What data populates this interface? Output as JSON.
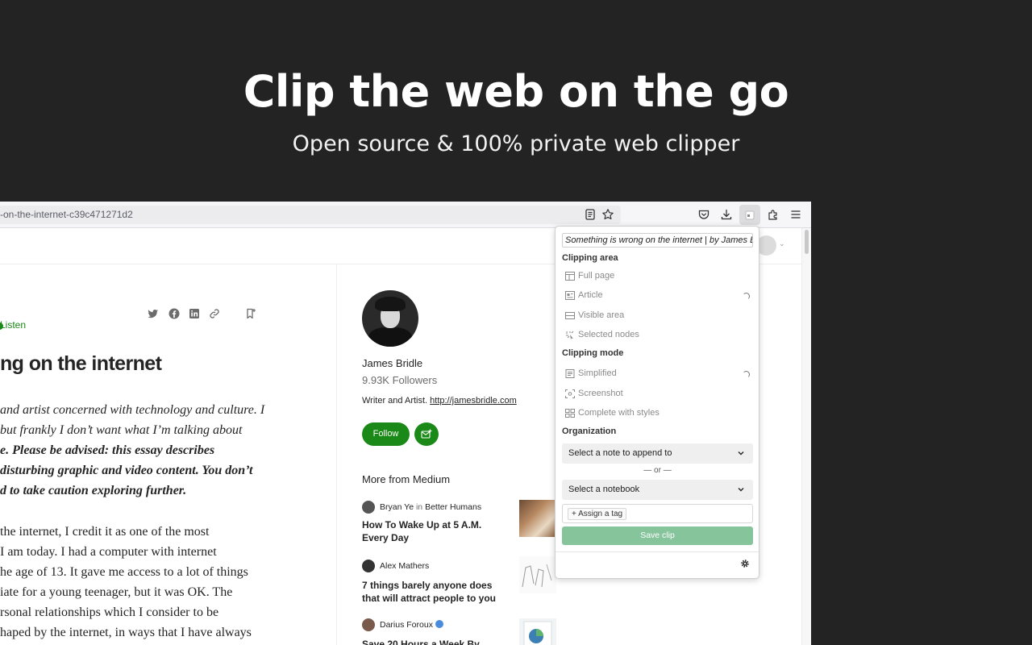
{
  "hero": {
    "title": "Clip the web on the go",
    "subtitle": "Open source & 100% private web clipper"
  },
  "browser": {
    "url": "-on-the-internet-c39c471271d2",
    "toolbar_icons": [
      "reader-view-icon",
      "bookmark-star-icon",
      "pocket-icon",
      "download-icon",
      "clipper-extension-icon",
      "extensions-icon",
      "menu-icon"
    ]
  },
  "article": {
    "listen_label": "Listen",
    "title": "ng on the internet",
    "intro_lines": [
      "and artist concerned with technology and culture. I",
      "but frankly I don’t want what I’m talking about",
      "e. Please be advised: this essay describes",
      "disturbing graphic and video content. You don’t",
      "d to take caution exploring further."
    ],
    "body_lines": [
      "the internet, I credit it as one of the most",
      " I am today. I had a computer with internet",
      "he age of 13. It gave me access to a lot of things",
      "iate for a young teenager, but it was OK. The",
      "rsonal relationships which I consider to be",
      "haped by the internet, in ways that I have always"
    ]
  },
  "sidebar": {
    "author_name": "James Bridle",
    "followers": "9.93K Followers",
    "bio_prefix": "Writer and Artist. ",
    "bio_link": "http://jamesbridle.com",
    "follow_label": "Follow",
    "more_from": "More from Medium",
    "recommendations": [
      {
        "author": "Bryan Ye",
        "in_label": "in",
        "publication": "Better Humans",
        "title": "How To Wake Up at 5 A.M. Every Day"
      },
      {
        "author": "Alex Mathers",
        "in_label": "",
        "publication": "",
        "title": "7 things barely anyone does that will attract people to you"
      },
      {
        "author": "Darius Foroux",
        "in_label": "",
        "publication": "",
        "title": "Save 20 Hours a Week By"
      }
    ]
  },
  "popup": {
    "title_value": "Something is wrong on the internet | by James Bridle",
    "clipping_area_heading": "Clipping area",
    "clipping_area_options": [
      "Full page",
      "Article",
      "Visible area",
      "Selected nodes"
    ],
    "clipping_mode_heading": "Clipping mode",
    "clipping_mode_options": [
      "Simplified",
      "Screenshot",
      "Complete with styles"
    ],
    "organization_heading": "Organization",
    "append_note_placeholder": "Select a note to append to",
    "or_label": "— or —",
    "notebook_placeholder": "Select a notebook",
    "assign_tag_label": "+ Assign a tag",
    "save_label": "Save clip",
    "accent_color": "#86c49b"
  },
  "colors": {
    "background": "#232323",
    "medium_green": "#1a8917"
  }
}
